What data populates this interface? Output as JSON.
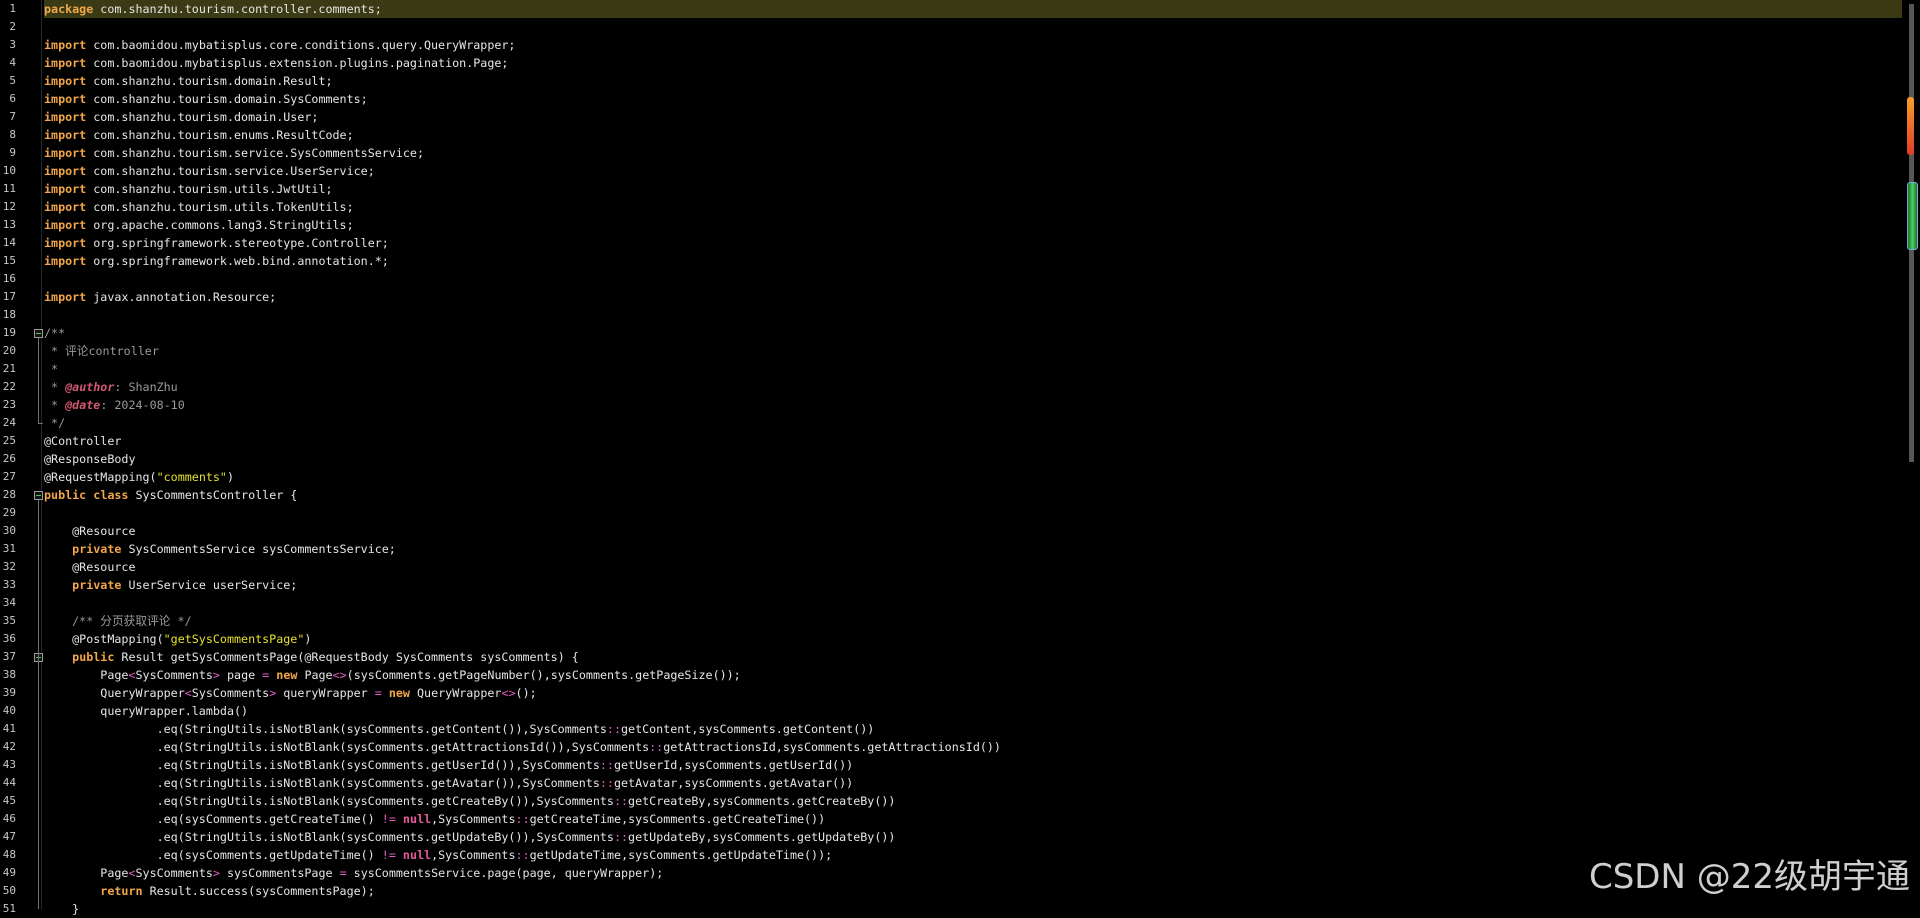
{
  "watermark": "CSDN @22级胡宇通",
  "colors": {
    "background": "#000000",
    "keyword": "#f2a64a",
    "string": "#e6e028",
    "comment": "#9a9a9a",
    "current_line": "#3a3a14"
  },
  "icons": {
    "fold": "fold-collapse-icon"
  },
  "fold_markers": [
    19,
    28,
    37
  ],
  "current_line": 1,
  "lines": [
    {
      "n": "1",
      "t": "package com.shanzhu.tourism.controller.comments;"
    },
    {
      "n": "2",
      "t": ""
    },
    {
      "n": "3",
      "t": "import com.baomidou.mybatisplus.core.conditions.query.QueryWrapper;"
    },
    {
      "n": "4",
      "t": "import com.baomidou.mybatisplus.extension.plugins.pagination.Page;"
    },
    {
      "n": "5",
      "t": "import com.shanzhu.tourism.domain.Result;"
    },
    {
      "n": "6",
      "t": "import com.shanzhu.tourism.domain.SysComments;"
    },
    {
      "n": "7",
      "t": "import com.shanzhu.tourism.domain.User;"
    },
    {
      "n": "8",
      "t": "import com.shanzhu.tourism.enums.ResultCode;"
    },
    {
      "n": "9",
      "t": "import com.shanzhu.tourism.service.SysCommentsService;"
    },
    {
      "n": "10",
      "t": "import com.shanzhu.tourism.service.UserService;"
    },
    {
      "n": "11",
      "t": "import com.shanzhu.tourism.utils.JwtUtil;"
    },
    {
      "n": "12",
      "t": "import com.shanzhu.tourism.utils.TokenUtils;"
    },
    {
      "n": "13",
      "t": "import org.apache.commons.lang3.StringUtils;"
    },
    {
      "n": "14",
      "t": "import org.springframework.stereotype.Controller;"
    },
    {
      "n": "15",
      "t": "import org.springframework.web.bind.annotation.*;"
    },
    {
      "n": "16",
      "t": ""
    },
    {
      "n": "17",
      "t": "import javax.annotation.Resource;"
    },
    {
      "n": "18",
      "t": ""
    },
    {
      "n": "19",
      "t": "/**"
    },
    {
      "n": "20",
      "t": " * 评论controller"
    },
    {
      "n": "21",
      "t": " *"
    },
    {
      "n": "22",
      "t": " * @author: ShanZhu"
    },
    {
      "n": "23",
      "t": " * @date: 2024-08-10"
    },
    {
      "n": "24",
      "t": " */"
    },
    {
      "n": "25",
      "t": "@Controller"
    },
    {
      "n": "26",
      "t": "@ResponseBody"
    },
    {
      "n": "27",
      "t": "@RequestMapping(\"comments\")"
    },
    {
      "n": "28",
      "t": "public class SysCommentsController {"
    },
    {
      "n": "29",
      "t": ""
    },
    {
      "n": "30",
      "t": "    @Resource"
    },
    {
      "n": "31",
      "t": "    private SysCommentsService sysCommentsService;"
    },
    {
      "n": "32",
      "t": "    @Resource"
    },
    {
      "n": "33",
      "t": "    private UserService userService;"
    },
    {
      "n": "34",
      "t": ""
    },
    {
      "n": "35",
      "t": "    /** 分页获取评论 */"
    },
    {
      "n": "36",
      "t": "    @PostMapping(\"getSysCommentsPage\")"
    },
    {
      "n": "37",
      "t": "    public Result getSysCommentsPage(@RequestBody SysComments sysComments) {"
    },
    {
      "n": "38",
      "t": "        Page<SysComments> page = new Page<>(sysComments.getPageNumber(),sysComments.getPageSize());"
    },
    {
      "n": "39",
      "t": "        QueryWrapper<SysComments> queryWrapper = new QueryWrapper<>();"
    },
    {
      "n": "40",
      "t": "        queryWrapper.lambda()"
    },
    {
      "n": "41",
      "t": "                .eq(StringUtils.isNotBlank(sysComments.getContent()),SysComments::getContent,sysComments.getContent())"
    },
    {
      "n": "42",
      "t": "                .eq(StringUtils.isNotBlank(sysComments.getAttractionsId()),SysComments::getAttractionsId,sysComments.getAttractionsId())"
    },
    {
      "n": "43",
      "t": "                .eq(StringUtils.isNotBlank(sysComments.getUserId()),SysComments::getUserId,sysComments.getUserId())"
    },
    {
      "n": "44",
      "t": "                .eq(StringUtils.isNotBlank(sysComments.getAvatar()),SysComments::getAvatar,sysComments.getAvatar())"
    },
    {
      "n": "45",
      "t": "                .eq(StringUtils.isNotBlank(sysComments.getCreateBy()),SysComments::getCreateBy,sysComments.getCreateBy())"
    },
    {
      "n": "46",
      "t": "                .eq(sysComments.getCreateTime() != null,SysComments::getCreateTime,sysComments.getCreateTime())"
    },
    {
      "n": "47",
      "t": "                .eq(StringUtils.isNotBlank(sysComments.getUpdateBy()),SysComments::getUpdateBy,sysComments.getUpdateBy())"
    },
    {
      "n": "48",
      "t": "                .eq(sysComments.getUpdateTime() != null,SysComments::getUpdateTime,sysComments.getUpdateTime());"
    },
    {
      "n": "49",
      "t": "        Page<SysComments> sysCommentsPage = sysCommentsService.page(page, queryWrapper);"
    },
    {
      "n": "50",
      "t": "        return Result.success(sysCommentsPage);"
    },
    {
      "n": "51",
      "t": "    }"
    }
  ]
}
